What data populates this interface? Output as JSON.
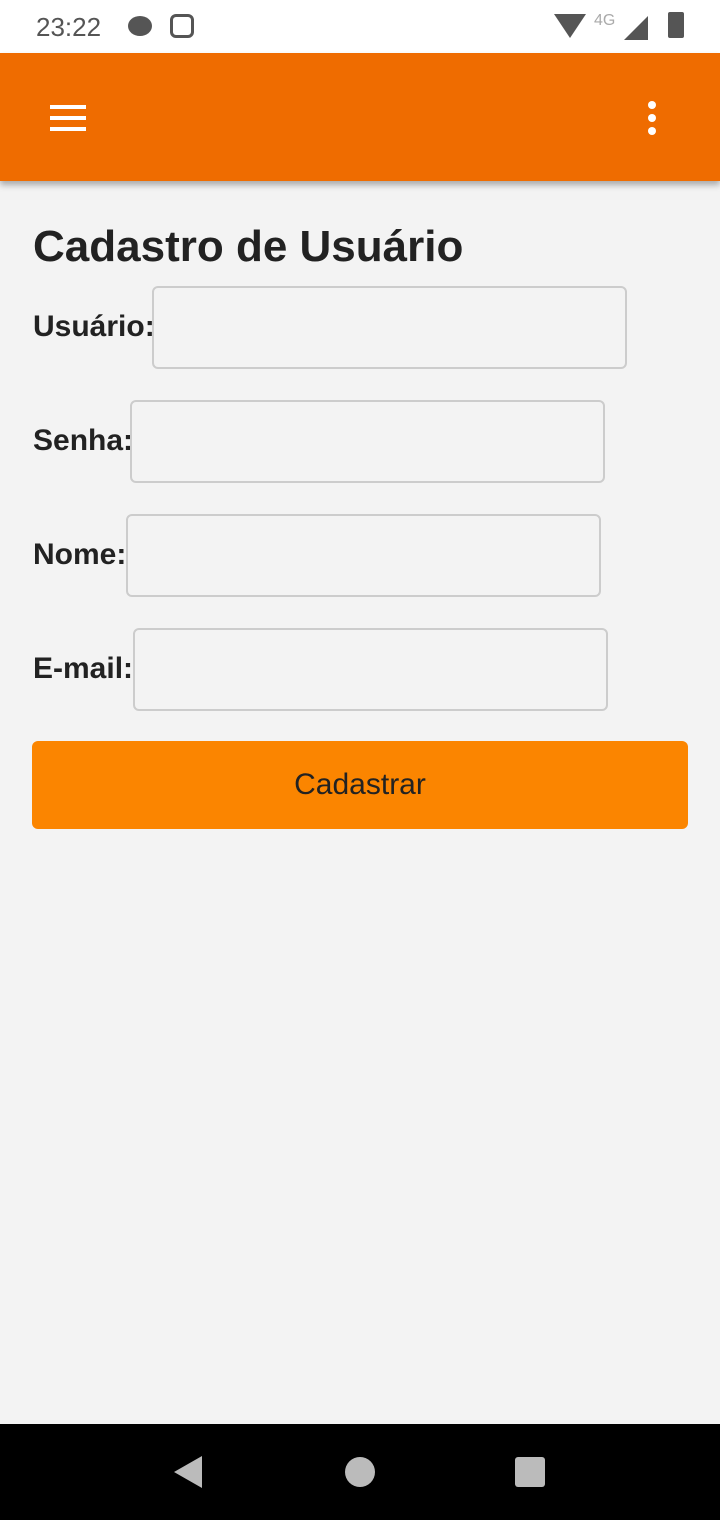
{
  "status": {
    "time": "23:22",
    "network": "4G"
  },
  "appbar": {
    "menu_icon": "hamburger-icon",
    "more_icon": "more-vert-icon",
    "color": "#ef6c00"
  },
  "form": {
    "title": "Cadastro de Usuário",
    "fields": [
      {
        "label": "Usuário:",
        "value": ""
      },
      {
        "label": "Senha:",
        "value": ""
      },
      {
        "label": "Nome:",
        "value": ""
      },
      {
        "label": "E-mail:",
        "value": ""
      }
    ],
    "submit": "Cadastrar",
    "button_color": "#fb8500"
  }
}
